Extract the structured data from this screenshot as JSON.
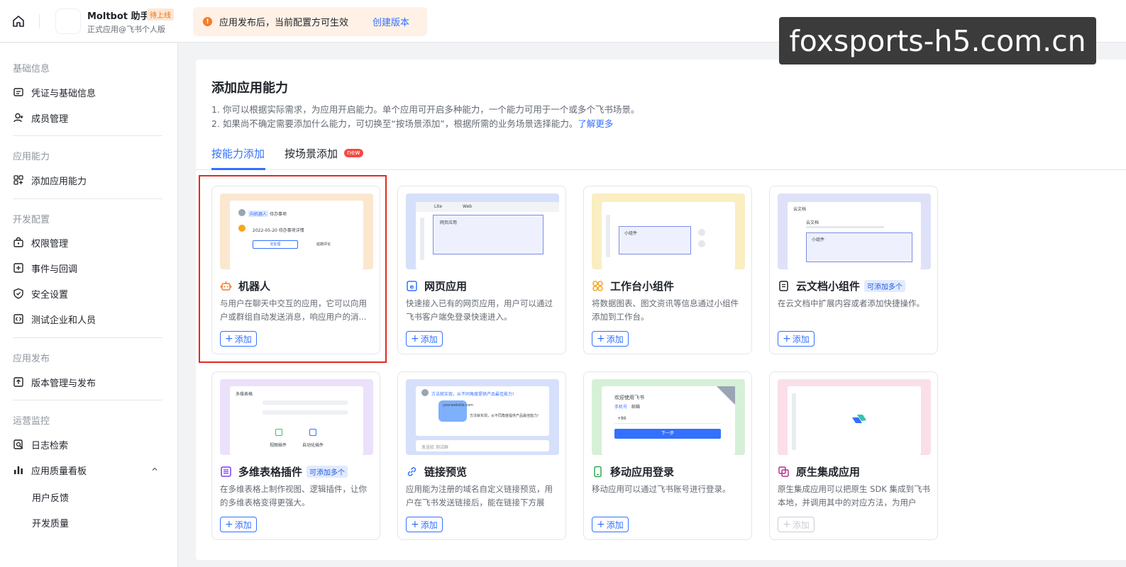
{
  "topbar": {
    "app_name": "Moltbot 助手",
    "app_status": "待上线",
    "app_subtitle": "正式应用@飞书个人版",
    "notice_text": "应用发布后，当前配置方可生效",
    "notice_link": "创建版本",
    "watermark": "foxsports-h5.com.cn"
  },
  "sidebar": {
    "sections": [
      {
        "title": "基础信息",
        "items": [
          "凭证与基础信息",
          "成员管理"
        ]
      },
      {
        "title": "应用能力",
        "items": [
          "添加应用能力"
        ]
      },
      {
        "title": "开发配置",
        "items": [
          "权限管理",
          "事件与回调",
          "安全设置",
          "测试企业和人员"
        ]
      },
      {
        "title": "应用发布",
        "items": [
          "版本管理与发布"
        ]
      },
      {
        "title": "运营监控",
        "items": [
          "日志检索",
          "应用质量看板"
        ],
        "subitems": [
          "用户反馈",
          "开发质量"
        ]
      }
    ]
  },
  "main": {
    "title": "添加应用能力",
    "desc_line1": "1. 你可以根据实际需求，为应用开启能力。单个应用可开启多种能力，一个能力可用于一个或多个飞书场景。",
    "desc_line2": "2. 如果尚不确定需要添加什么能力，可切换至“按场景添加”，根据所需的业务场景选择能力。",
    "desc_link": "了解更多",
    "tabs": [
      "按能力添加",
      "按场景添加"
    ],
    "new_badge": "new",
    "multi_badge": "可添加多个",
    "add_label": "添加",
    "cards": [
      {
        "title": "机器人",
        "desc": "与用户在聊天中交互的应用，它可以向用户或群组自动发送消息，响应用户的消..."
      },
      {
        "title": "网页应用",
        "desc": "快速接入已有的网页应用，用户可以通过飞书客户端免登录快速进入。"
      },
      {
        "title": "工作台小组件",
        "desc": "将数据图表、图文资讯等信息通过小组件添加到工作台。"
      },
      {
        "title": "云文档小组件",
        "desc": "在云文档中扩展内容或者添加快捷操作。"
      },
      {
        "title": "多维表格插件",
        "desc": "在多维表格上制作视图、逻辑插件，让你的多维表格变得更强大。"
      },
      {
        "title": "链接预览",
        "desc": "应用能为注册的域名自定义链接预览，用户在飞书发送链接后，能在链接下方展示..."
      },
      {
        "title": "移动应用登录",
        "desc": "移动应用可以通过飞书账号进行登录。"
      },
      {
        "title": "原生集成应用",
        "desc": "原生集成应用可以把原生 SDK 集成到飞书本地，并调用其中的对应方法，为用户提..."
      }
    ],
    "thumbs": {
      "bot_chip": "向机器人",
      "bot_chip2": "待办事项",
      "bot_line": "2022-05-20 待办事项详情",
      "bot_btn1": "去处理",
      "bot_btn2": "延期评论",
      "web_tab1": "Lite",
      "web_tab2": "Web",
      "web_box": "网页应用",
      "widget_box": "小组件",
      "doc_nav": "云文档",
      "doc_title": "云文档",
      "doc_box": "小组件",
      "base_nav": "多维表格",
      "base_a": "视图插件",
      "base_b": "自动化插件",
      "link_head": "方法就实现，从不同角度提供产品最佳能力!",
      "link_url": "yourwebsite.com",
      "link_body": "方法就实现，从不同角度提供产品最佳能力!",
      "link_input": "发送给 测试群",
      "login_title": "欢迎使用飞书",
      "login_tab1": "手机号",
      "login_tab2": "邮箱",
      "login_code": "+86",
      "login_btn": "下一步"
    }
  }
}
